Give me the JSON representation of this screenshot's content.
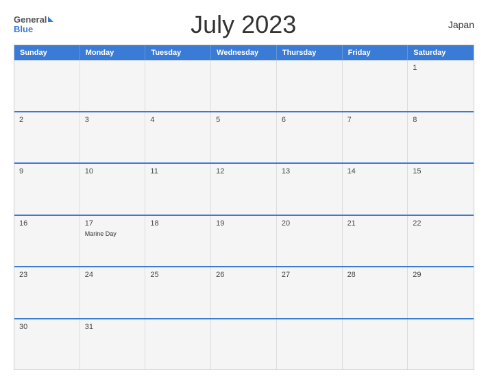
{
  "header": {
    "logo_general": "General",
    "logo_blue": "Blue",
    "title": "July 2023",
    "country": "Japan"
  },
  "days_of_week": [
    "Sunday",
    "Monday",
    "Tuesday",
    "Wednesday",
    "Thursday",
    "Friday",
    "Saturday"
  ],
  "weeks": [
    [
      {
        "day": "",
        "empty": true
      },
      {
        "day": "",
        "empty": true
      },
      {
        "day": "",
        "empty": true
      },
      {
        "day": "",
        "empty": true
      },
      {
        "day": "",
        "empty": true
      },
      {
        "day": "",
        "empty": true
      },
      {
        "day": "1",
        "empty": false
      }
    ],
    [
      {
        "day": "2",
        "empty": false
      },
      {
        "day": "3",
        "empty": false
      },
      {
        "day": "4",
        "empty": false
      },
      {
        "day": "5",
        "empty": false
      },
      {
        "day": "6",
        "empty": false
      },
      {
        "day": "7",
        "empty": false
      },
      {
        "day": "8",
        "empty": false
      }
    ],
    [
      {
        "day": "9",
        "empty": false
      },
      {
        "day": "10",
        "empty": false
      },
      {
        "day": "11",
        "empty": false
      },
      {
        "day": "12",
        "empty": false
      },
      {
        "day": "13",
        "empty": false
      },
      {
        "day": "14",
        "empty": false
      },
      {
        "day": "15",
        "empty": false
      }
    ],
    [
      {
        "day": "16",
        "empty": false
      },
      {
        "day": "17",
        "empty": false,
        "event": "Marine Day"
      },
      {
        "day": "18",
        "empty": false
      },
      {
        "day": "19",
        "empty": false
      },
      {
        "day": "20",
        "empty": false
      },
      {
        "day": "21",
        "empty": false
      },
      {
        "day": "22",
        "empty": false
      }
    ],
    [
      {
        "day": "23",
        "empty": false
      },
      {
        "day": "24",
        "empty": false
      },
      {
        "day": "25",
        "empty": false
      },
      {
        "day": "26",
        "empty": false
      },
      {
        "day": "27",
        "empty": false
      },
      {
        "day": "28",
        "empty": false
      },
      {
        "day": "29",
        "empty": false
      }
    ],
    [
      {
        "day": "30",
        "empty": false
      },
      {
        "day": "31",
        "empty": false
      },
      {
        "day": "",
        "empty": true
      },
      {
        "day": "",
        "empty": true
      },
      {
        "day": "",
        "empty": true
      },
      {
        "day": "",
        "empty": true
      },
      {
        "day": "",
        "empty": true
      }
    ]
  ],
  "colors": {
    "accent": "#3a7bd5",
    "header_bg": "#3a7bd5",
    "cell_bg": "#f5f5f5"
  }
}
